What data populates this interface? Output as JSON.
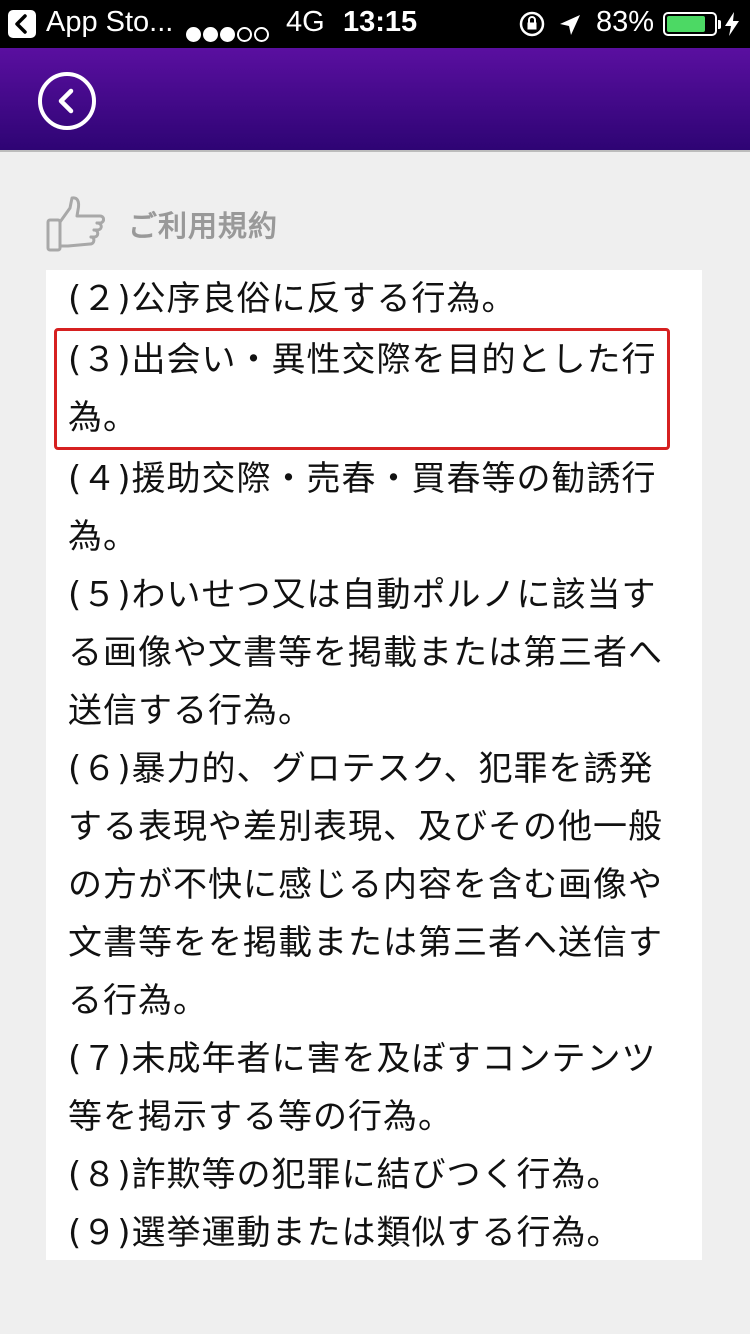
{
  "status_bar": {
    "back_app": "App Sto...",
    "network": "4G",
    "time": "13:15",
    "battery": "83%",
    "battery_level": 0.83
  },
  "section": {
    "title": "ご利用規約"
  },
  "terms": [
    {
      "text": "(２)公序良俗に反する行為。",
      "highlighted": false
    },
    {
      "text": "(３)出会い・異性交際を目的とした行為。",
      "highlighted": true
    },
    {
      "text": "(４)援助交際・売春・買春等の勧誘行為。",
      "highlighted": false
    },
    {
      "text": "(５)わいせつ又は自動ポルノに該当する画像や文書等を掲載または第三者へ送信する行為。",
      "highlighted": false
    },
    {
      "text": "(６)暴力的、グロテスク、犯罪を誘発する表現や差別表現、及びその他一般の方が不快に感じる内容を含む画像や文書等をを掲載または第三者へ送信する行為。",
      "highlighted": false
    },
    {
      "text": "(７)未成年者に害を及ぼすコンテンツ等を掲示する等の行為。",
      "highlighted": false
    },
    {
      "text": "(８)詐欺等の犯罪に結びつく行為。",
      "highlighted": false
    },
    {
      "text": "(９)選挙運動または類似する行為。",
      "highlighted": false
    }
  ],
  "colors": {
    "nav_top": "#5a0fa0",
    "nav_bottom": "#2e0474",
    "highlight_border": "#d62020"
  }
}
